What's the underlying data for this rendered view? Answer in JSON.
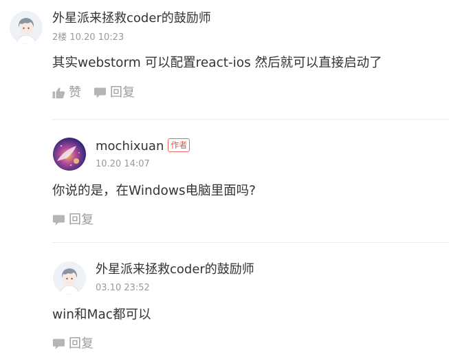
{
  "comments": [
    {
      "author": "外星派来拯救coder的鼓励师",
      "meta": "2楼 10.20 10:23",
      "text": "其实webstorm 可以配置react-ios 然后就可以直接启动了",
      "actions": {
        "like": "赞",
        "reply": "回复"
      }
    },
    {
      "author": "mochixuan",
      "author_tag": "作者",
      "meta": "10.20 14:07",
      "text": "你说的是，在Windows电脑里面吗?",
      "actions": {
        "reply": "回复"
      }
    },
    {
      "author": "外星派来拯救coder的鼓励师",
      "meta": "03.10 23:52",
      "text": "win和Mac都可以",
      "actions": {
        "reply": "回复"
      }
    }
  ],
  "icons": {
    "like": "thumbs-up-icon",
    "reply": "comment-bubble-icon"
  },
  "colors": {
    "author_tag": "#e05243",
    "muted": "#9a9a9a",
    "divider": "#ececec"
  }
}
